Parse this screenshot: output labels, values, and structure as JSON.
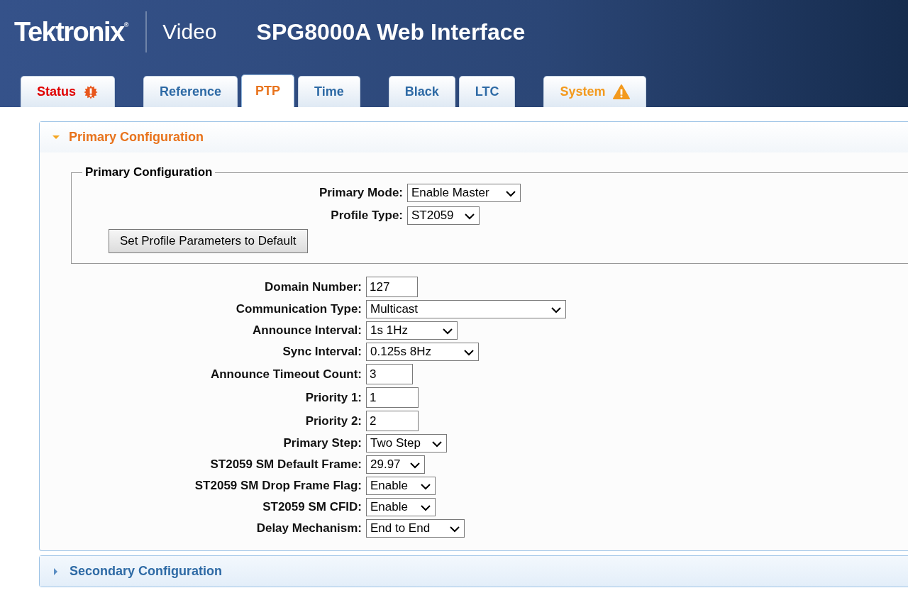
{
  "header": {
    "brand": "Tektronix$^{®}$",
    "product": "Video",
    "title": "SPG8000A Web Interface"
  },
  "tab_groups": [
    [
      {
        "label": "Status",
        "selected": false,
        "kind": "error"
      }
    ],
    [
      {
        "label": "Reference",
        "selected": false,
        "kind": "plain"
      },
      {
        "label": "PTP",
        "selected": true,
        "kind": "plain"
      },
      {
        "label": "Time",
        "selected": false,
        "kind": "plain"
      }
    ],
    [
      {
        "label": "Black",
        "selected": false,
        "kind": "plain"
      },
      {
        "label": "LTC",
        "selected": false,
        "kind": "plain"
      }
    ],
    [
      {
        "label": "System",
        "selected": false,
        "kind": "warning"
      }
    ]
  ],
  "panels": [
    {
      "title": "Primary Configuration",
      "expanded": true,
      "fieldset": {
        "legend": "Primary Configuration",
        "fields": [
          {
            "label": "Primary Mode:",
            "kind": "select",
            "value": "Enable Master"
          },
          {
            "label": "Profile Type:",
            "kind": "select",
            "value": "ST2059"
          }
        ],
        "button": "Set Profile Parameters to Default"
      },
      "fields": [
        {
          "label": "Domain Number:",
          "kind": "text",
          "value": "127"
        },
        {
          "label": "Communication Type:",
          "kind": "select",
          "value": "Multicast"
        },
        {
          "label": "Announce Interval:",
          "kind": "select",
          "value": "1s 1Hz"
        },
        {
          "label": "Sync Interval:",
          "kind": "select",
          "value": "0.125s 8Hz"
        },
        {
          "label": "Announce Timeout Count:",
          "kind": "text",
          "value": "3"
        },
        {
          "label": "Priority 1:",
          "kind": "text",
          "value": "1"
        },
        {
          "label": "Priority 2:",
          "kind": "text",
          "value": "2"
        },
        {
          "label": "Primary Step:",
          "kind": "select",
          "value": "Two Step"
        },
        {
          "label": "ST2059 SM Default Frame:",
          "kind": "select",
          "value": "29.97"
        },
        {
          "label": "ST2059 SM Drop Frame Flag:",
          "kind": "select",
          "value": "Enable"
        },
        {
          "label": "ST2059 SM CFID:",
          "kind": "select",
          "value": "Enable"
        },
        {
          "label": "Delay Mechanism:",
          "kind": "select",
          "value": "End to End"
        }
      ]
    },
    {
      "title": "Secondary Configuration",
      "expanded": false
    }
  ]
}
